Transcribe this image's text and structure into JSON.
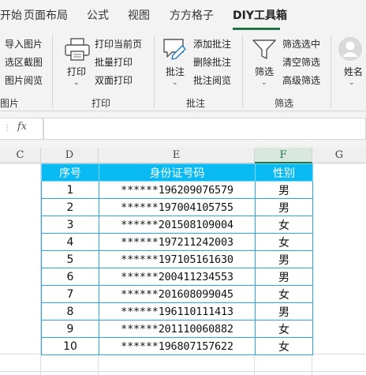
{
  "tabs": [
    "开始",
    "页面布局",
    "公式",
    "视图",
    "方方格子",
    "DIY工具箱"
  ],
  "active_tab": "DIY工具箱",
  "ribbon": {
    "groups": {
      "image": {
        "label": "图片",
        "items": [
          "导入图片",
          "选区截图",
          "图片阅览"
        ]
      },
      "print": {
        "label": "打印",
        "big": "打印",
        "items": [
          "打印当前页",
          "批量打印",
          "双面打印"
        ]
      },
      "comment": {
        "label": "批注",
        "big": "批注",
        "items": [
          "添加批注",
          "删除批注",
          "批注阅览"
        ]
      },
      "filter": {
        "label": "筛选",
        "big": "筛选",
        "items": [
          "筛选选中",
          "清空筛选",
          "高级筛选"
        ]
      },
      "name": {
        "label": "姓名"
      }
    }
  },
  "formula_bar": {
    "fx": "fx",
    "value": ""
  },
  "columns": [
    "C",
    "D",
    "E",
    "F",
    "G"
  ],
  "selected_column": "F",
  "table": {
    "headers": [
      "序号",
      "身份证号码",
      "性别"
    ],
    "rows": [
      [
        "1",
        "******196209076579",
        "男"
      ],
      [
        "2",
        "******197004105755",
        "男"
      ],
      [
        "3",
        "******201508109004",
        "女"
      ],
      [
        "4",
        "******197211242003",
        "女"
      ],
      [
        "5",
        "******197105161630",
        "男"
      ],
      [
        "6",
        "******200411234553",
        "男"
      ],
      [
        "7",
        "******201608099045",
        "女"
      ],
      [
        "8",
        "******196110111413",
        "男"
      ],
      [
        "9",
        "******201110060882",
        "女"
      ],
      [
        "10",
        "******196807157622",
        "女"
      ]
    ]
  },
  "colors": {
    "accent": "#217346",
    "header_fill": "#0abbf3",
    "table_border": "#2ea7dd"
  }
}
